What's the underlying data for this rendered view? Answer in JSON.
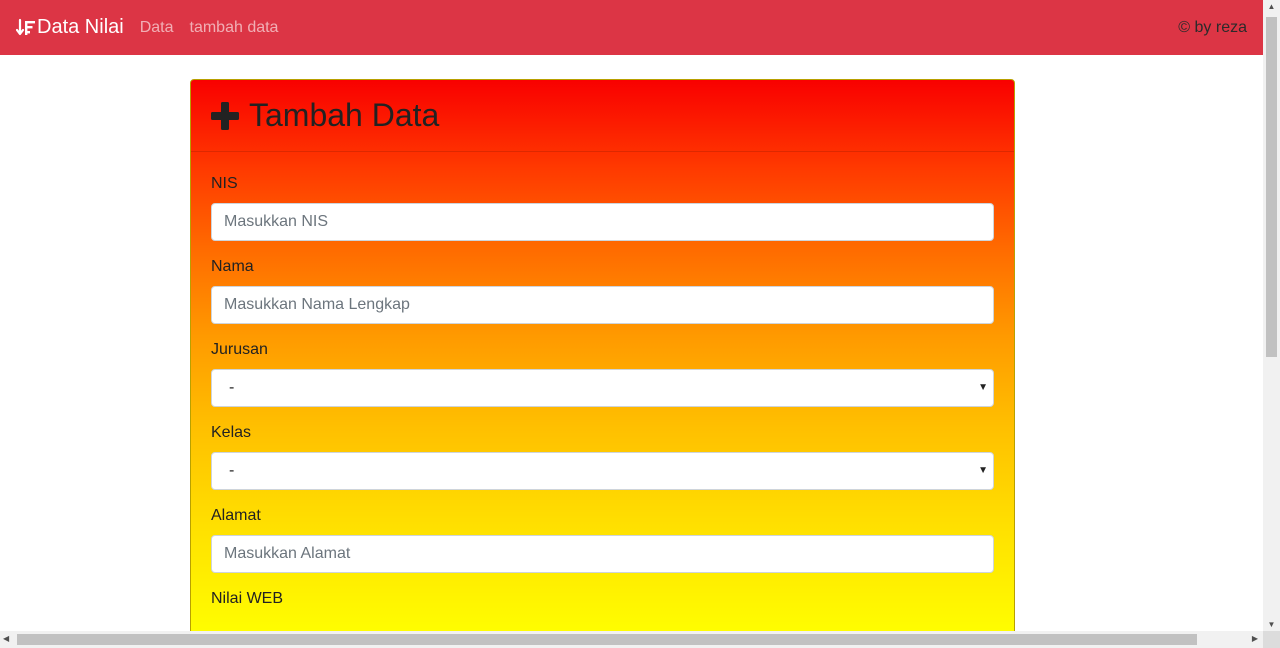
{
  "navbar": {
    "brand": "Data Nilai",
    "brand_icon": "sort-down-icon",
    "links": [
      "Data",
      "tambah data"
    ],
    "credit": "© by reza",
    "bg_color": "#dc3545"
  },
  "card": {
    "title": "Tambah Data",
    "title_icon": "plus-icon"
  },
  "form": {
    "nis": {
      "label": "NIS",
      "placeholder": "Masukkan NIS",
      "value": ""
    },
    "nama": {
      "label": "Nama",
      "placeholder": "Masukkan Nama Lengkap",
      "value": ""
    },
    "jurusan": {
      "label": "Jurusan",
      "selected": "-"
    },
    "kelas": {
      "label": "Kelas",
      "selected": "-"
    },
    "alamat": {
      "label": "Alamat",
      "placeholder": "Masukkan Alamat",
      "value": ""
    },
    "nilai_web": {
      "label": "Nilai WEB"
    }
  }
}
